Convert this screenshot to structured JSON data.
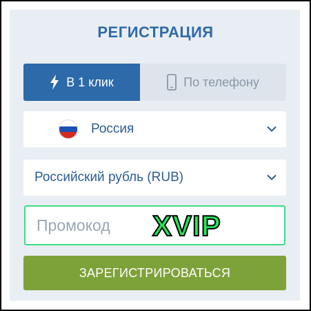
{
  "form": {
    "title": "РЕГИСТРАЦИЯ",
    "tabs": [
      {
        "label": "В 1 клик",
        "icon": "lightning-bolt-icon",
        "active": true
      },
      {
        "label": "По телефону",
        "icon": "mobile-phone-icon",
        "active": false
      }
    ],
    "country": {
      "value": "Россия",
      "icon": "russia-flag-icon"
    },
    "currency": {
      "value": "Российский рубль (RUB)"
    },
    "promo": {
      "placeholder": "Промокод",
      "code": "XVIP"
    },
    "submit_label": "ЗАРЕГИСТРИРОВАТЬСЯ"
  },
  "colors": {
    "accent_blue": "#2c6aa9",
    "title_blue": "#2f6aa8",
    "submit_green": "#7ea23a",
    "promo_border": "#3ddc84",
    "promo_code_green": "#20e85a",
    "panel_bg": "#e9eef4"
  }
}
